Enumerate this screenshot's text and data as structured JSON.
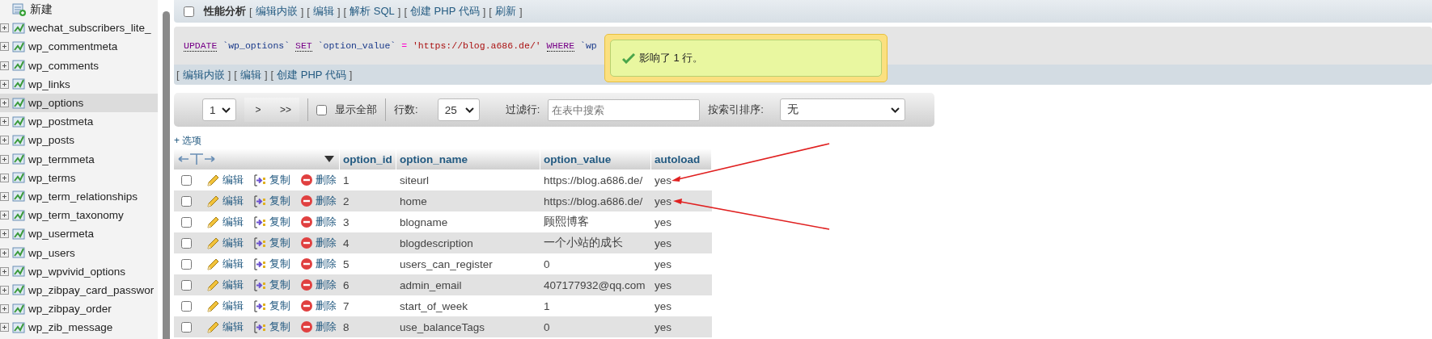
{
  "sidebar": {
    "items": [
      {
        "label": "新建",
        "kind": "new",
        "selected": false
      },
      {
        "label": "wechat_subscribers_lite_",
        "kind": "table",
        "selected": false
      },
      {
        "label": "wp_commentmeta",
        "kind": "table",
        "selected": false
      },
      {
        "label": "wp_comments",
        "kind": "table",
        "selected": false
      },
      {
        "label": "wp_links",
        "kind": "table",
        "selected": false
      },
      {
        "label": "wp_options",
        "kind": "table",
        "selected": true
      },
      {
        "label": "wp_postmeta",
        "kind": "table",
        "selected": false
      },
      {
        "label": "wp_posts",
        "kind": "table",
        "selected": false
      },
      {
        "label": "wp_termmeta",
        "kind": "table",
        "selected": false
      },
      {
        "label": "wp_terms",
        "kind": "table",
        "selected": false
      },
      {
        "label": "wp_term_relationships",
        "kind": "table",
        "selected": false
      },
      {
        "label": "wp_term_taxonomy",
        "kind": "table",
        "selected": false
      },
      {
        "label": "wp_usermeta",
        "kind": "table",
        "selected": false
      },
      {
        "label": "wp_users",
        "kind": "table",
        "selected": false
      },
      {
        "label": "wp_wpvivid_options",
        "kind": "table",
        "selected": false
      },
      {
        "label": "wp_zibpay_card_passwor",
        "kind": "table",
        "selected": false
      },
      {
        "label": "wp_zibpay_order",
        "kind": "table",
        "selected": false
      },
      {
        "label": "wp_zib_message",
        "kind": "table",
        "selected": false
      }
    ]
  },
  "top_bar": {
    "profiling": {
      "label": "性能分析",
      "checked": false
    },
    "brackets": [
      "[",
      "]"
    ],
    "links": [
      "编辑内嵌",
      "编辑",
      "解析 SQL",
      "创建 PHP 代码",
      "刷新"
    ]
  },
  "sql": {
    "tokens": [
      {
        "kind": "keyword",
        "text": "UPDATE"
      },
      {
        "kind": "identifier",
        "text": "`wp_options`"
      },
      {
        "kind": "keyword",
        "text": "SET"
      },
      {
        "kind": "identifier",
        "text": "`option_value`"
      },
      {
        "kind": "operator",
        "text": "="
      },
      {
        "kind": "string",
        "text": "'https://blog.a686.de/'"
      },
      {
        "kind": "keyword",
        "text": "WHERE"
      },
      {
        "kind": "identifier",
        "text": "`wp"
      }
    ],
    "brackets": [
      "[",
      "]"
    ],
    "links": [
      "编辑内嵌",
      "编辑",
      "创建 PHP 代码"
    ]
  },
  "notice": {
    "text": "影响了 1 行。"
  },
  "navigation": {
    "page": "1",
    "next": ">",
    "last": ">>",
    "show_all": {
      "label": "显示全部",
      "checked": false
    },
    "rows_label": "行数:",
    "rows_value": "25",
    "filter_label": "过滤行:",
    "filter_placeholder": "在表中搜索",
    "sort_label": "按索引排序:",
    "sort_value": "无"
  },
  "options_link": "+ 选项",
  "table": {
    "columns": [
      "option_id",
      "option_name",
      "option_value",
      "autoload"
    ],
    "rows": [
      {
        "checked": false,
        "actions": [
          "编辑",
          "复制",
          "删除"
        ],
        "cells": [
          "1",
          "siteurl",
          "https://blog.a686.de/",
          "yes"
        ]
      },
      {
        "checked": false,
        "actions": [
          "编辑",
          "复制",
          "删除"
        ],
        "cells": [
          "2",
          "home",
          "https://blog.a686.de/",
          "yes"
        ]
      },
      {
        "checked": false,
        "actions": [
          "编辑",
          "复制",
          "删除"
        ],
        "cells": [
          "3",
          "blogname",
          "顾熙博客",
          "yes"
        ]
      },
      {
        "checked": false,
        "actions": [
          "编辑",
          "复制",
          "删除"
        ],
        "cells": [
          "4",
          "blogdescription",
          "一个小站的成长",
          "yes"
        ]
      },
      {
        "checked": false,
        "actions": [
          "编辑",
          "复制",
          "删除"
        ],
        "cells": [
          "5",
          "users_can_register",
          "0",
          "yes"
        ]
      },
      {
        "checked": false,
        "actions": [
          "编辑",
          "复制",
          "删除"
        ],
        "cells": [
          "6",
          "admin_email",
          "407177932@qq.com",
          "yes"
        ]
      },
      {
        "checked": false,
        "actions": [
          "编辑",
          "复制",
          "删除"
        ],
        "cells": [
          "7",
          "start_of_week",
          "1",
          "yes"
        ]
      },
      {
        "checked": false,
        "actions": [
          "编辑",
          "复制",
          "删除"
        ],
        "cells": [
          "8",
          "use_balanceTags",
          "0",
          "yes"
        ]
      }
    ]
  }
}
